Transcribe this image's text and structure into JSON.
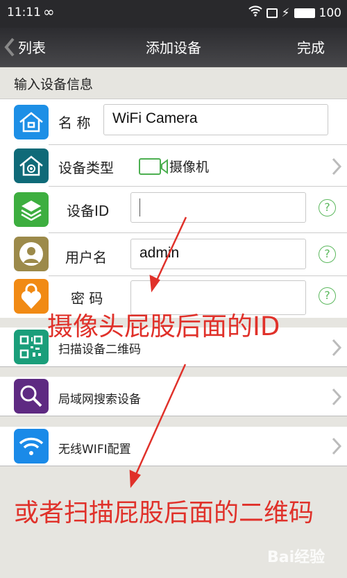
{
  "status_bar": {
    "time": "11:11",
    "battery": "100"
  },
  "nav": {
    "back_label": "列表",
    "title": "添加设备",
    "done_label": "完成"
  },
  "section_title": "输入设备信息",
  "form": {
    "name": {
      "label": "名 称",
      "value": "WiFi Camera"
    },
    "type": {
      "label": "设备类型",
      "value": "摄像机"
    },
    "device_id": {
      "label": "设备ID",
      "value": ""
    },
    "username": {
      "label": "用户名",
      "value": "admin"
    },
    "password": {
      "label": "密 码",
      "value": ""
    }
  },
  "actions": [
    {
      "label": "扫描设备二维码",
      "icon": "qr-code-icon",
      "color": "#1a9e7a"
    },
    {
      "label": "局域网搜索设备",
      "icon": "search-icon",
      "color": "#5e2a82"
    },
    {
      "label": "无线WIFI配置",
      "icon": "wifi-icon",
      "color": "#1a8ae8"
    }
  ],
  "annotations": {
    "id_note": "摄像头屁股后面的ID",
    "qr_note": "或者扫描屁股后面的二维码",
    "color": "#e0312a"
  },
  "watermark": "Bai经验"
}
